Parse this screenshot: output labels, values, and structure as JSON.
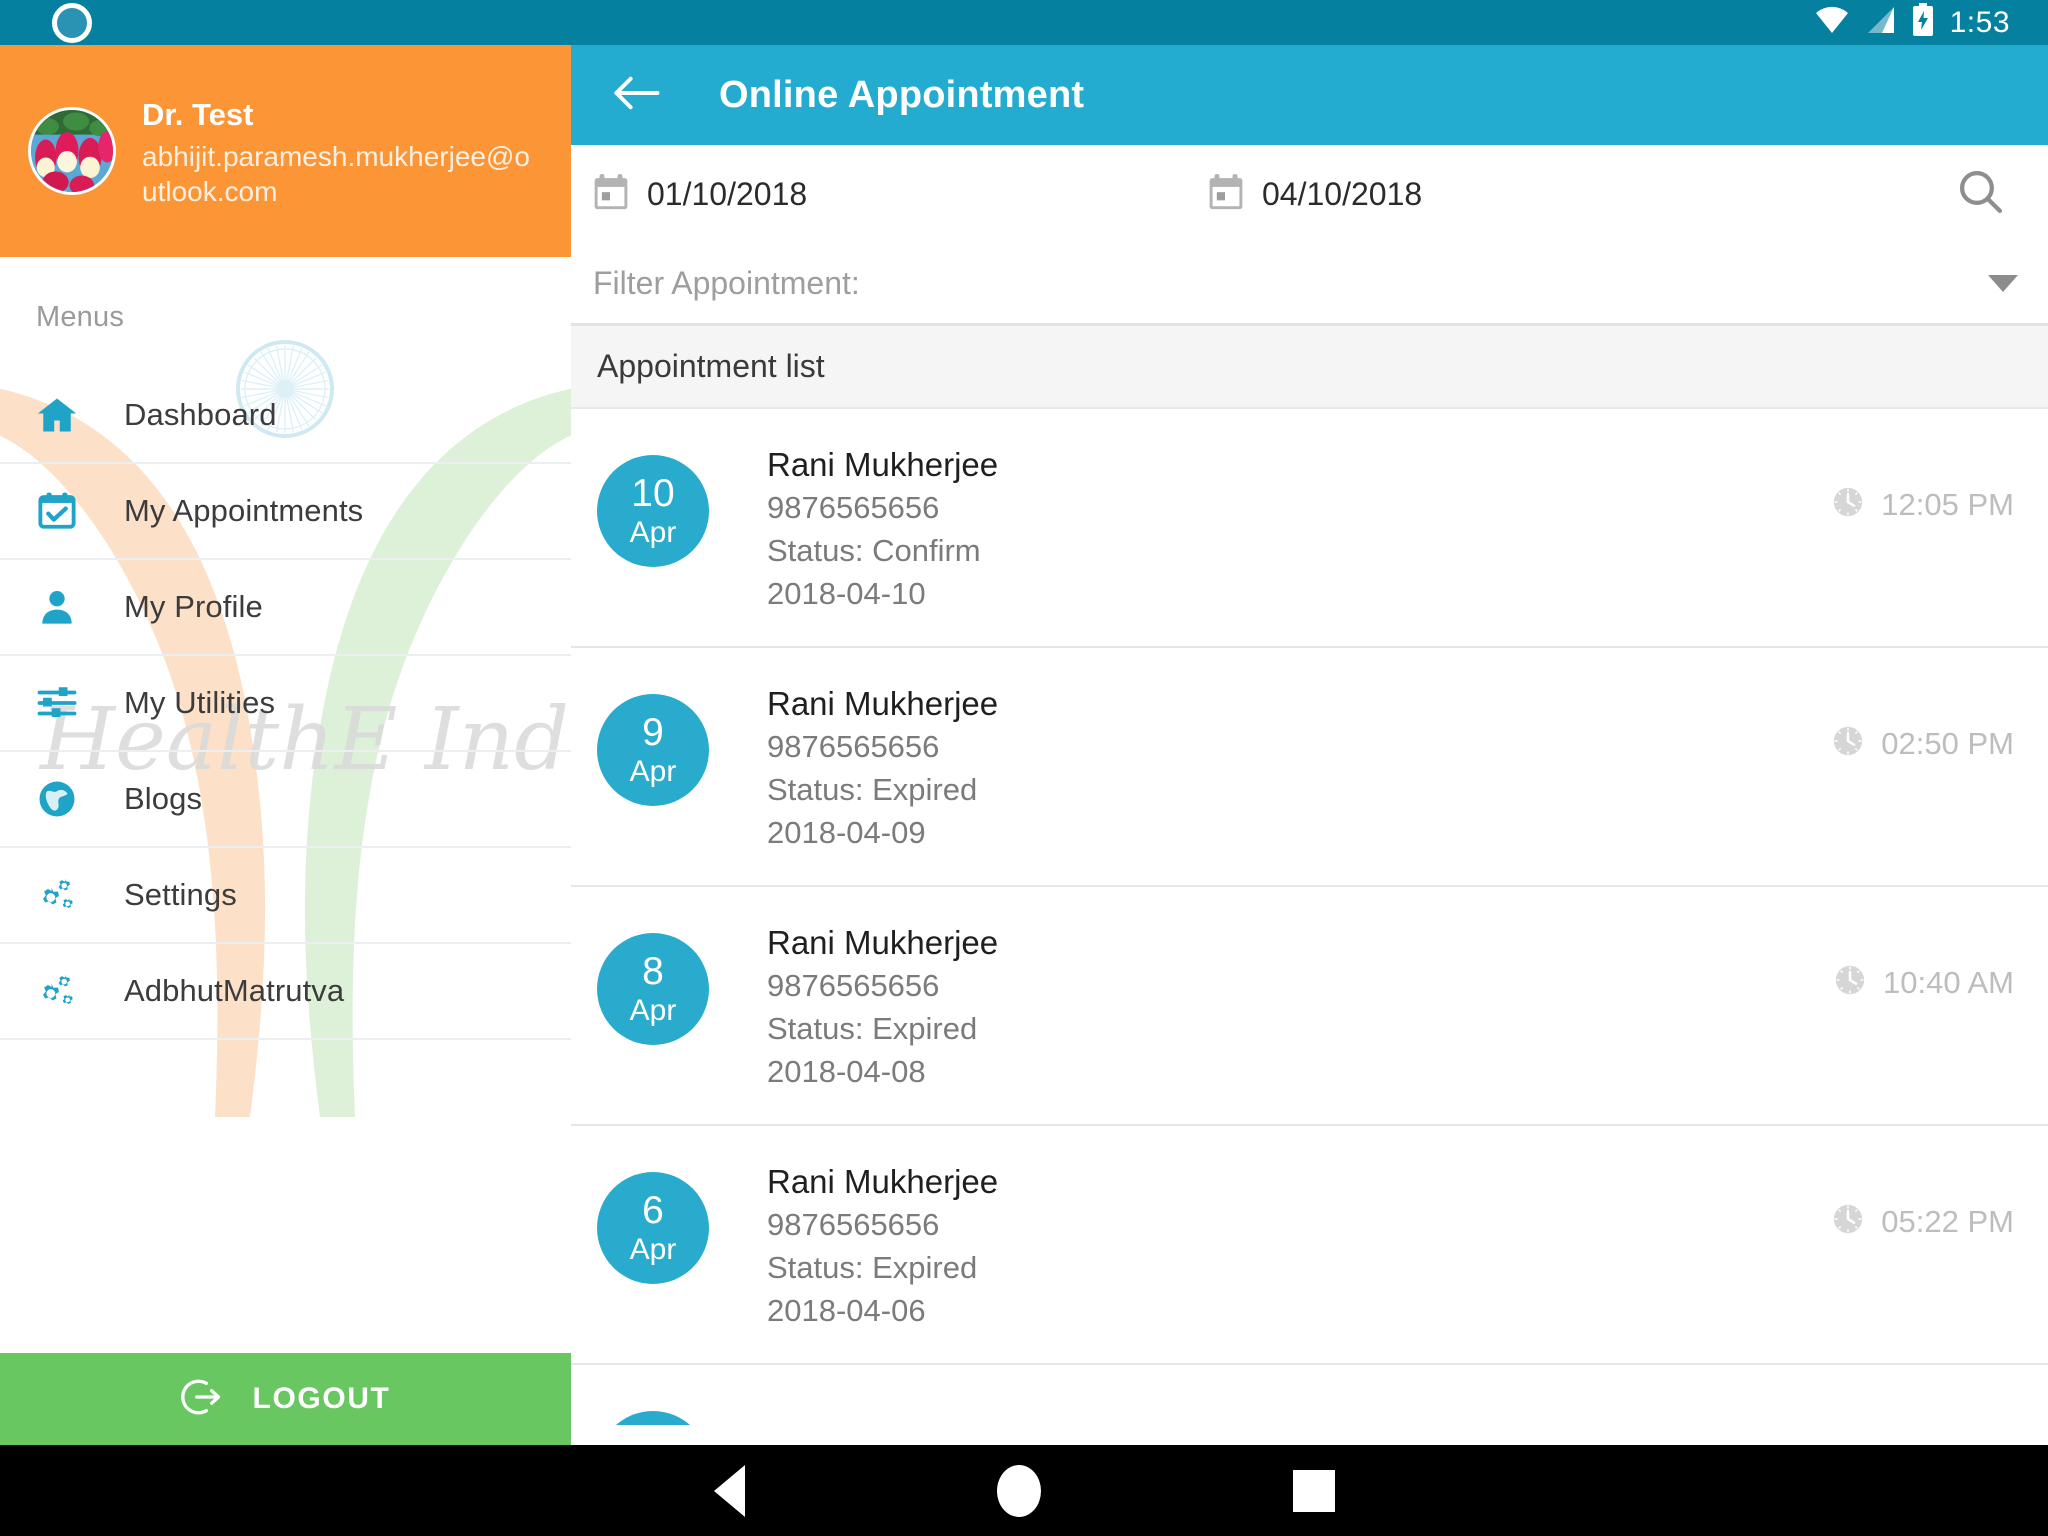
{
  "status_bar": {
    "time": "1:53",
    "icons": [
      "wifi-icon",
      "cellular-signal-icon",
      "battery-charging-icon"
    ],
    "background_color": "#06809f"
  },
  "drawer": {
    "background_color": "#ffffff",
    "header": {
      "background_color": "#fb9536",
      "avatar": "user-avatar-tulips",
      "name": "Dr. Test",
      "email": "abhijit.paramesh.mukherjee@outlook.com"
    },
    "section_label": "Menus",
    "items": [
      {
        "label": "Dashboard",
        "icon": "home-icon"
      },
      {
        "label": "My Appointments",
        "icon": "calendar-check-icon"
      },
      {
        "label": "My Profile",
        "icon": "person-icon"
      },
      {
        "label": "My Utilities",
        "icon": "sliders-icon"
      },
      {
        "label": "Blogs",
        "icon": "globe-icon"
      },
      {
        "label": "Settings",
        "icon": "gears-icon"
      },
      {
        "label": "AdbhutMatrutva",
        "icon": "gears-icon"
      }
    ],
    "watermark_text": "HealthE India",
    "logout": {
      "label": "LOGOUT",
      "icon": "logout-icon",
      "background_color": "#69c762"
    },
    "icon_color": "#1fa4c8"
  },
  "toolbar": {
    "back_icon": "arrow-left-icon",
    "title": "Online Appointment",
    "background_color": "#23accf"
  },
  "filters": {
    "from_date": "01/10/2018",
    "to_date": "04/10/2018",
    "from_icon": "calendar-icon",
    "to_icon": "calendar-icon",
    "search_icon": "search-icon",
    "filter_label": "Filter Appointment:",
    "filter_value": "",
    "dropdown_icon": "chevron-down-icon"
  },
  "list": {
    "header": "Appointment list",
    "time_icon": "clock-icon",
    "circle_color": "#29abce",
    "rows": [
      {
        "day": "10",
        "month": "Apr",
        "name": "Rani Mukherjee",
        "phone": "9876565656",
        "status": "Status: Confirm",
        "date": "2018-04-10",
        "time": "12:05 PM"
      },
      {
        "day": "9",
        "month": "Apr",
        "name": "Rani Mukherjee",
        "phone": "9876565656",
        "status": "Status: Expired",
        "date": "2018-04-09",
        "time": "02:50 PM"
      },
      {
        "day": "8",
        "month": "Apr",
        "name": "Rani Mukherjee",
        "phone": "9876565656",
        "status": "Status: Expired",
        "date": "2018-04-08",
        "time": "10:40 AM"
      },
      {
        "day": "6",
        "month": "Apr",
        "name": "Rani Mukherjee",
        "phone": "9876565656",
        "status": "Status: Expired",
        "date": "2018-04-06",
        "time": "05:22 PM"
      },
      {
        "day": "",
        "month": "",
        "name": "",
        "phone": "",
        "status": "",
        "date": "",
        "time": ""
      }
    ]
  },
  "navigation_bar": {
    "background_color": "#000000",
    "buttons": [
      "back-nav-icon",
      "home-nav-icon",
      "recents-nav-icon"
    ]
  }
}
